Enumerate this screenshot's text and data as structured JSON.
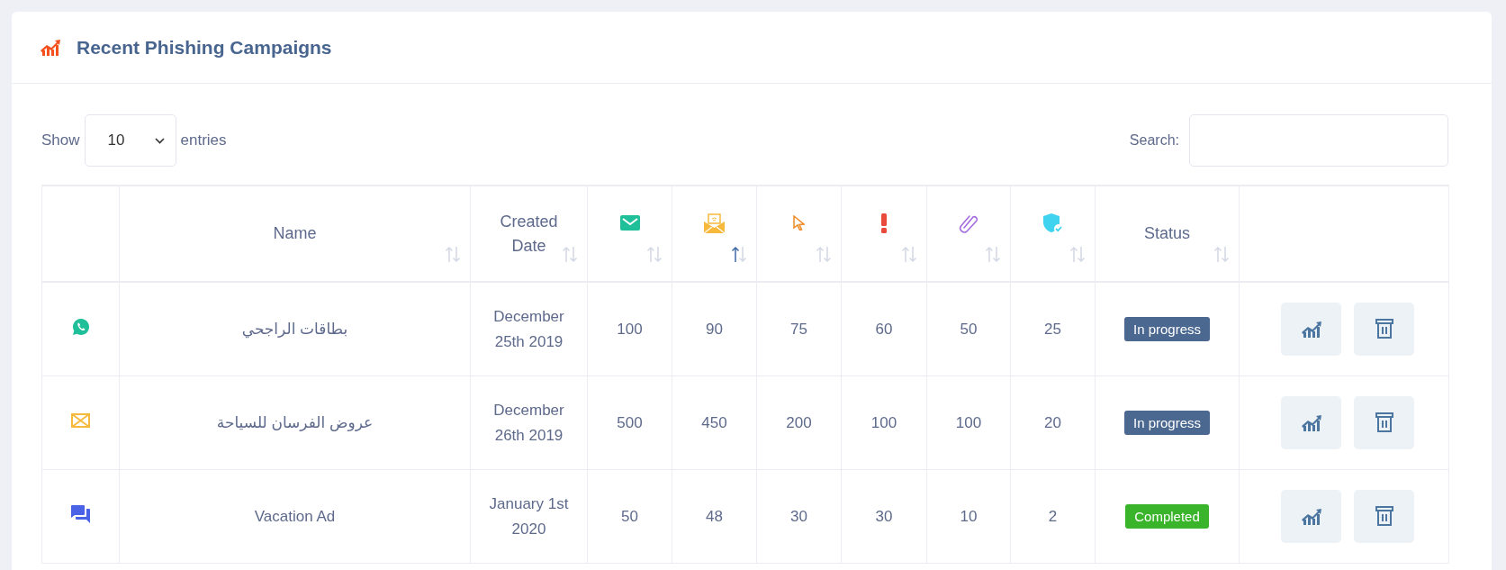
{
  "card": {
    "title": "Recent Phishing Campaigns"
  },
  "length_control": {
    "prefix": "Show",
    "value": "10",
    "suffix": "entries"
  },
  "search": {
    "label": "Search:"
  },
  "table": {
    "columns": [
      {
        "kind": "blank"
      },
      {
        "kind": "text",
        "label": "Name",
        "sorted_ascending": false
      },
      {
        "kind": "text",
        "label": "Created Date",
        "sorted_ascending": false
      },
      {
        "kind": "sent",
        "sorted_ascending": false
      },
      {
        "kind": "opened",
        "sorted_ascending": true
      },
      {
        "kind": "clicked",
        "sorted_ascending": false
      },
      {
        "kind": "alert",
        "sorted_ascending": false
      },
      {
        "kind": "attachment",
        "sorted_ascending": false
      },
      {
        "kind": "shield",
        "sorted_ascending": false
      },
      {
        "kind": "text",
        "label": "Status",
        "sorted_ascending": false
      },
      {
        "kind": "blank_actions"
      }
    ],
    "rows": [
      {
        "kind": "whatsapp",
        "name": "بطاقات الراجحي",
        "date": "December 25th 2019",
        "counts": [
          "100",
          "90",
          "75",
          "60",
          "50",
          "25"
        ],
        "status": {
          "kind": "in_progress",
          "label": "In progress"
        }
      },
      {
        "kind": "email",
        "name": "عروض الفرسان للسياحة",
        "date": "December 26th 2019",
        "counts": [
          "500",
          "450",
          "200",
          "100",
          "100",
          "20"
        ],
        "status": {
          "kind": "in_progress",
          "label": "In progress"
        }
      },
      {
        "kind": "chat",
        "name": "Vacation Ad",
        "date": "January 1st 2020",
        "counts": [
          "50",
          "48",
          "30",
          "30",
          "10",
          "2"
        ],
        "status": {
          "kind": "completed",
          "label": "Completed"
        }
      }
    ]
  }
}
